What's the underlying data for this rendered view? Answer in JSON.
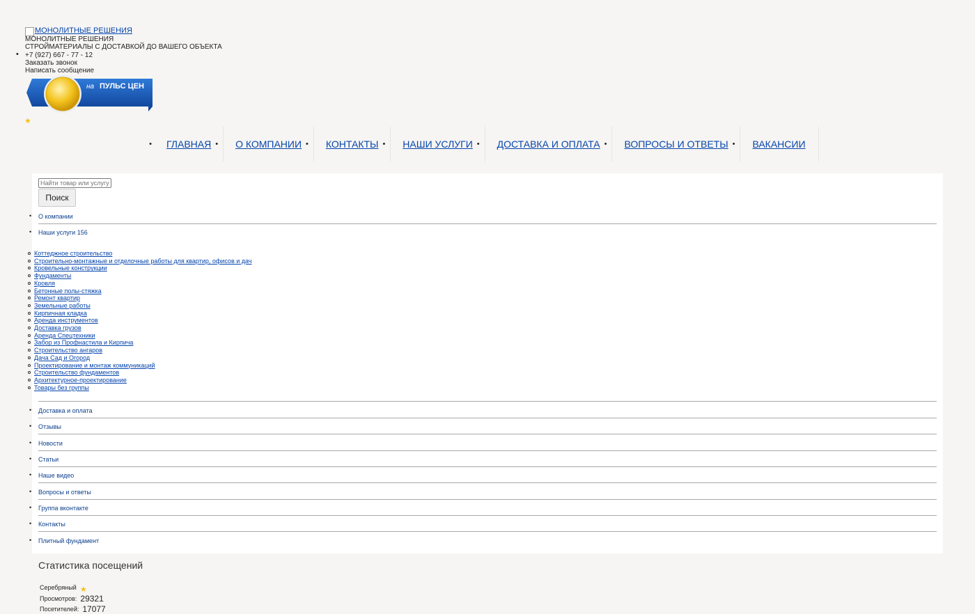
{
  "header": {
    "logo_alt": "МОНОЛИТНЫЕ РЕШЕНИЯ",
    "company": "МОНОЛИТНЫЕ РЕШЕНИЯ",
    "tagline": "СТРОЙМАТЕРИАЛЫ С ДОСТАВКОЙ ДО ВАШЕГО ОБЪЕКТА",
    "phone": "+7 (927) 667 - 77 - 12",
    "callback": "Заказать звонок",
    "message": "Написать сообщение"
  },
  "badge": {
    "prefix": "на",
    "brand": "ПУЛЬС ЦЕН",
    "icon": "gold-medal-icon"
  },
  "topnav": [
    "ГЛАВНАЯ",
    "О КОМПАНИИ",
    "КОНТАКТЫ",
    "НАШИ УСЛУГИ",
    "ДОСТАВКА И ОПЛАТА",
    "ВОПРОСЫ И ОТВЕТЫ",
    "ВАКАНСИИ"
  ],
  "search": {
    "placeholder": "Найти товар или услугу",
    "button": "Поиск"
  },
  "side_menu": {
    "about": "О компании",
    "services": "Наши услуги 156",
    "services_sub": [
      "Коттеджное строительство",
      "Строительно-монтажные и отделочные работы для квартир, офисов и дач",
      "Кровельные конструкции",
      "Фундаменты",
      "Кровля",
      "Бетонные полы-стяжка",
      "Ремонт квартир",
      "Земельные работы",
      "Кирпичная кладка",
      "Аренда инструментов",
      "Доставка грузов",
      "Аренда Спецтехники",
      "Забор из Профнастила и Кирпича",
      "Строительство ангаров",
      "Дача Сад и Огород",
      "Проектирование и монтаж коммуникаций",
      "Строительство фундаментов",
      "Архитектурное-проектирование",
      "Товары без группы"
    ],
    "rest": [
      "Доставка и оплата",
      "Отзывы",
      "Новости",
      "Статьи",
      "Наше видео",
      "Вопросы и ответы",
      "Группа вконтакте",
      "Контакты",
      "Плитный фундамент"
    ]
  },
  "stats": {
    "title": "Статистика посещений",
    "level": "Серебряный",
    "views_label": "Просмотров:",
    "views": "29321",
    "visitors_label": "Посетителей:",
    "visitors": "17077"
  },
  "colors": {
    "link": "#0645ad",
    "menu_link": "#0b3f8c",
    "star": "#f2c21b",
    "badge_blue": "#1a5db8",
    "badge_gold": "#f0b90b"
  }
}
